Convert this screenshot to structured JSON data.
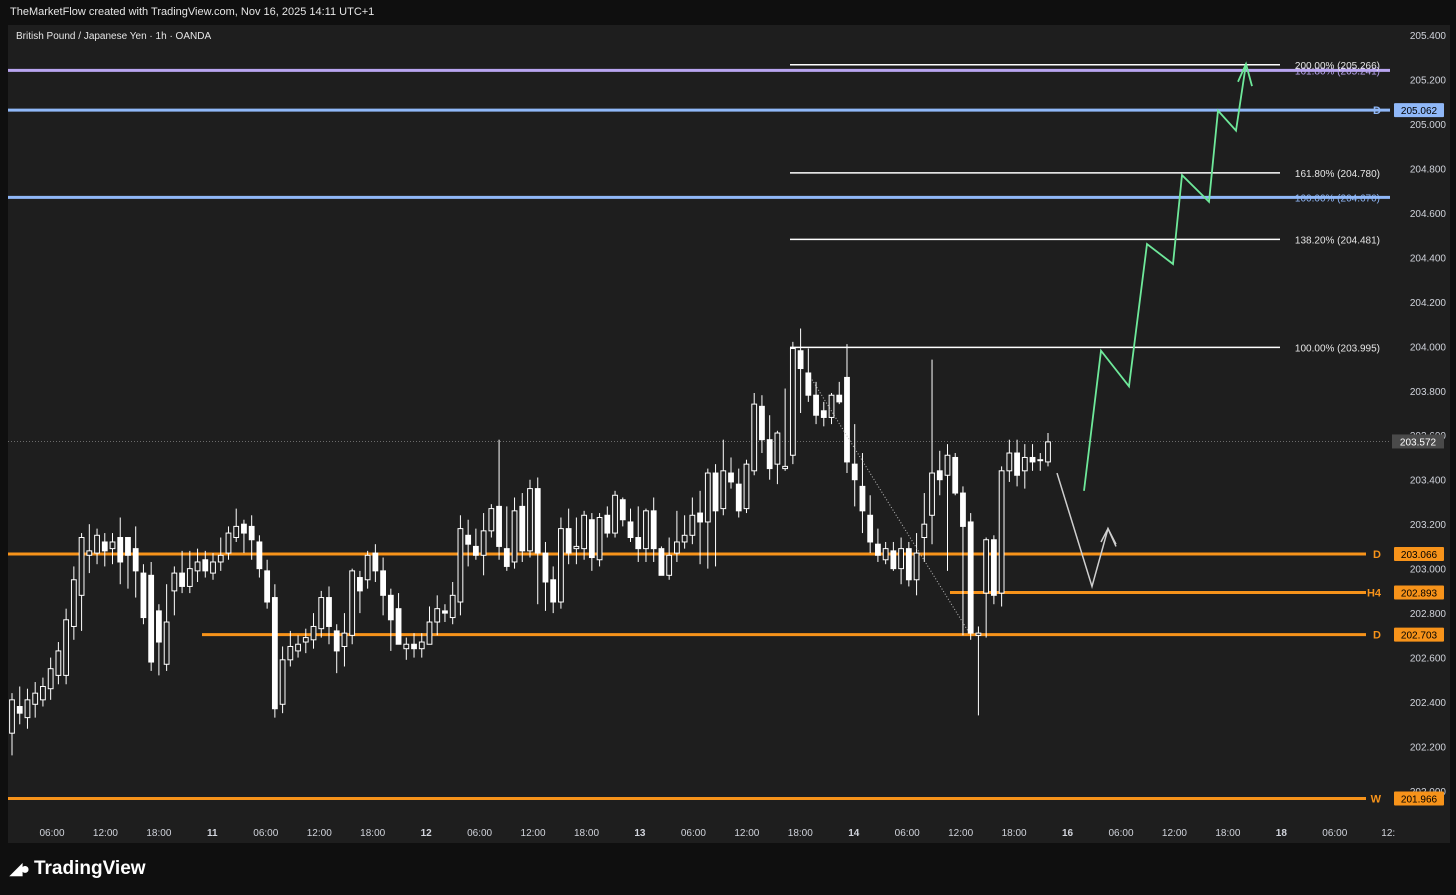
{
  "header": {
    "attribution": "TheMarketFlow created with TradingView.com, Nov 16, 2025 14:11 UTC+1",
    "symbol_title": "British Pound / Japanese Yen · 1h · OANDA"
  },
  "footer": {
    "brand": "TradingView"
  },
  "colors": {
    "background": "#1e1e1e",
    "bull_candle": "#ffffff",
    "bear_candle": "#ffffff",
    "orange_level": "#f7931a",
    "blue_level": "#90b8f8",
    "purple_level": "#b9a5f0",
    "projection_green": "#6ee89a",
    "projection_white": "#cfcfcf",
    "fib_line": "#ffffff"
  },
  "chart_data": {
    "type": "candlestick",
    "title": "British Pound / Japanese Yen · 1h · OANDA",
    "y_axis": {
      "ticks": [
        "205.400",
        "205.200",
        "205.000",
        "204.800",
        "204.600",
        "204.400",
        "204.200",
        "204.000",
        "203.800",
        "203.600",
        "203.400",
        "203.200",
        "203.000",
        "202.800",
        "202.600",
        "202.400",
        "202.200",
        "202.000"
      ],
      "range": [
        201.9,
        205.45
      ]
    },
    "x_axis": {
      "ticks": [
        "06:00",
        "12:00",
        "18:00",
        "11",
        "06:00",
        "12:00",
        "18:00",
        "12",
        "06:00",
        "12:00",
        "18:00",
        "13",
        "06:00",
        "12:00",
        "18:00",
        "14",
        "06:00",
        "12:00",
        "18:00",
        "16",
        "06:00",
        "12:00",
        "18:00",
        "18",
        "06:00",
        "12:"
      ]
    },
    "current_price": "203.572",
    "horizontal_levels": [
      {
        "label": "D",
        "value": "205.062",
        "color": "blue"
      },
      {
        "label": "",
        "value": "204.670",
        "text": "100.00% (204.670)",
        "color": "blue"
      },
      {
        "label": "",
        "value": "205.241",
        "text": "161.80% (205.241)",
        "color": "purple"
      },
      {
        "label": "D",
        "value": "203.066",
        "color": "orange"
      },
      {
        "label": "H4",
        "value": "202.893",
        "color": "orange"
      },
      {
        "label": "D",
        "value": "202.703",
        "color": "orange"
      },
      {
        "label": "W",
        "value": "201.966",
        "color": "orange"
      }
    ],
    "fib_extensions": [
      {
        "text": "200.00% (205.266)",
        "value": 205.266
      },
      {
        "text": "161.80% (204.780)",
        "value": 204.78
      },
      {
        "text": "138.20% (204.481)",
        "value": 204.481
      },
      {
        "text": "100.00% (203.995)",
        "value": 203.995
      }
    ],
    "projection_path_green": [
      [
        1,
        203.35
      ],
      [
        2,
        203.98
      ],
      [
        3,
        203.82
      ],
      [
        4,
        204.46
      ],
      [
        5,
        204.37
      ],
      [
        6,
        204.77
      ],
      [
        7,
        204.65
      ],
      [
        8,
        205.06
      ],
      [
        9,
        204.97
      ],
      [
        10,
        205.27
      ]
    ],
    "projection_path_white": [
      [
        1,
        203.43
      ],
      [
        2,
        202.92
      ],
      [
        3,
        203.18
      ],
      [
        4,
        203.11
      ]
    ],
    "candles": [
      [
        202.26,
        202.41,
        202.16,
        202.44
      ],
      [
        202.38,
        202.35,
        202.3,
        202.47
      ],
      [
        202.33,
        202.41,
        202.28,
        202.46
      ],
      [
        202.39,
        202.44,
        202.33,
        202.49
      ],
      [
        202.41,
        202.47,
        202.38,
        202.51
      ],
      [
        202.46,
        202.55,
        202.41,
        202.6
      ],
      [
        202.52,
        202.63,
        202.48,
        202.67
      ],
      [
        202.52,
        202.77,
        202.48,
        202.82
      ],
      [
        202.74,
        202.95,
        202.68,
        203.01
      ],
      [
        202.88,
        203.14,
        202.72,
        203.16
      ],
      [
        203.06,
        203.08,
        202.98,
        203.2
      ],
      [
        203.07,
        203.15,
        203.02,
        203.18
      ],
      [
        203.12,
        203.08,
        203.01,
        203.16
      ],
      [
        203.09,
        203.12,
        203.02,
        203.16
      ],
      [
        203.14,
        203.03,
        202.93,
        203.23
      ],
      [
        203.14,
        203.06,
        202.91,
        203.14
      ],
      [
        203.09,
        202.99,
        202.87,
        203.19
      ],
      [
        202.98,
        202.78,
        202.75,
        203.02
      ],
      [
        202.97,
        202.58,
        202.54,
        203.03
      ],
      [
        202.81,
        202.67,
        202.52,
        202.84
      ],
      [
        202.57,
        202.76,
        202.54,
        202.93
      ],
      [
        202.9,
        202.98,
        202.79,
        203.01
      ],
      [
        202.98,
        202.92,
        202.89,
        203.08
      ],
      [
        202.92,
        203.0,
        202.89,
        203.08
      ],
      [
        202.99,
        203.03,
        202.94,
        203.09
      ],
      [
        203.04,
        202.99,
        202.96,
        203.08
      ],
      [
        202.98,
        203.03,
        202.95,
        203.07
      ],
      [
        203.03,
        203.06,
        202.99,
        203.14
      ],
      [
        203.07,
        203.16,
        203.04,
        203.19
      ],
      [
        203.14,
        203.19,
        203.12,
        203.27
      ],
      [
        203.2,
        203.16,
        203.07,
        203.22
      ],
      [
        203.19,
        203.13,
        203.04,
        203.24
      ],
      [
        203.12,
        203.0,
        202.96,
        203.15
      ],
      [
        202.99,
        202.85,
        202.82,
        203.04
      ],
      [
        202.87,
        202.37,
        202.33,
        202.93
      ],
      [
        202.39,
        202.59,
        202.35,
        202.65
      ],
      [
        202.59,
        202.65,
        202.56,
        202.72
      ],
      [
        202.63,
        202.66,
        202.6,
        202.7
      ],
      [
        202.67,
        202.69,
        202.62,
        202.73
      ],
      [
        202.68,
        202.74,
        202.64,
        202.8
      ],
      [
        202.73,
        202.87,
        202.69,
        202.9
      ],
      [
        202.87,
        202.74,
        202.66,
        202.92
      ],
      [
        202.72,
        202.63,
        202.53,
        202.75
      ],
      [
        202.65,
        202.71,
        202.56,
        202.8
      ],
      [
        202.7,
        202.99,
        202.66,
        203.0
      ],
      [
        202.96,
        202.9,
        202.8,
        202.99
      ],
      [
        202.95,
        203.06,
        202.91,
        203.08
      ],
      [
        203.07,
        202.99,
        202.94,
        203.11
      ],
      [
        202.99,
        202.88,
        202.79,
        203.05
      ],
      [
        202.88,
        202.77,
        202.63,
        202.91
      ],
      [
        202.82,
        202.66,
        202.66,
        202.89
      ],
      [
        202.64,
        202.66,
        202.59,
        202.69
      ],
      [
        202.66,
        202.64,
        202.6,
        202.71
      ],
      [
        202.64,
        202.67,
        202.6,
        202.71
      ],
      [
        202.66,
        202.76,
        202.66,
        202.83
      ],
      [
        202.76,
        202.82,
        202.7,
        202.88
      ],
      [
        202.81,
        202.8,
        202.76,
        202.84
      ],
      [
        202.78,
        202.88,
        202.75,
        202.94
      ],
      [
        202.85,
        203.18,
        202.79,
        203.24
      ],
      [
        203.15,
        203.11,
        203.01,
        203.22
      ],
      [
        203.1,
        203.06,
        203.04,
        203.18
      ],
      [
        203.06,
        203.17,
        202.97,
        203.25
      ],
      [
        203.17,
        203.27,
        203.14,
        203.29
      ],
      [
        203.28,
        203.1,
        203.04,
        203.58
      ],
      [
        203.09,
        203.01,
        202.99,
        203.28
      ],
      [
        203.03,
        203.26,
        203.0,
        203.32
      ],
      [
        203.28,
        203.08,
        203.03,
        203.34
      ],
      [
        203.08,
        203.36,
        203.05,
        203.4
      ],
      [
        203.36,
        203.07,
        202.84,
        203.41
      ],
      [
        203.07,
        202.94,
        202.81,
        203.12
      ],
      [
        202.95,
        202.85,
        202.8,
        203.01
      ],
      [
        202.85,
        203.18,
        202.82,
        203.23
      ],
      [
        203.18,
        203.07,
        203.02,
        203.27
      ],
      [
        203.09,
        203.1,
        203.02,
        203.23
      ],
      [
        203.09,
        203.24,
        203.04,
        203.26
      ],
      [
        203.22,
        203.05,
        202.99,
        203.25
      ],
      [
        203.04,
        203.23,
        203.01,
        203.25
      ],
      [
        203.24,
        203.16,
        203.14,
        203.28
      ],
      [
        203.16,
        203.33,
        203.14,
        203.35
      ],
      [
        203.31,
        203.22,
        203.19,
        203.32
      ],
      [
        203.21,
        203.14,
        203.12,
        203.27
      ],
      [
        203.14,
        203.09,
        203.03,
        203.28
      ],
      [
        203.09,
        203.26,
        203.03,
        203.27
      ],
      [
        203.26,
        203.09,
        203.03,
        203.32
      ],
      [
        203.09,
        202.97,
        202.97,
        203.1
      ],
      [
        202.97,
        203.06,
        202.95,
        203.14
      ],
      [
        203.07,
        203.12,
        203.03,
        203.26
      ],
      [
        203.12,
        203.15,
        203.09,
        203.24
      ],
      [
        203.15,
        203.24,
        203.11,
        203.32
      ],
      [
        203.25,
        203.21,
        203.02,
        203.35
      ],
      [
        203.21,
        203.43,
        203.0,
        203.45
      ],
      [
        203.43,
        203.26,
        203.01,
        203.47
      ],
      [
        203.27,
        203.44,
        203.24,
        203.58
      ],
      [
        203.43,
        203.39,
        203.36,
        203.5
      ],
      [
        203.38,
        203.26,
        203.23,
        203.45
      ],
      [
        203.27,
        203.47,
        203.25,
        203.49
      ],
      [
        203.44,
        203.74,
        203.42,
        203.79
      ],
      [
        203.73,
        203.58,
        203.52,
        203.78
      ],
      [
        203.58,
        203.45,
        203.4,
        203.69
      ],
      [
        203.47,
        203.61,
        203.38,
        203.62
      ],
      [
        203.45,
        203.46,
        203.44,
        203.81
      ],
      [
        203.51,
        203.99,
        203.47,
        204.02
      ],
      [
        203.98,
        203.9,
        203.7,
        204.08
      ],
      [
        203.88,
        203.78,
        203.75,
        203.99
      ],
      [
        203.78,
        203.69,
        203.65,
        203.84
      ],
      [
        203.71,
        203.68,
        203.64,
        203.75
      ],
      [
        203.68,
        203.78,
        203.65,
        203.79
      ],
      [
        203.78,
        203.75,
        203.74,
        203.84
      ],
      [
        203.86,
        203.48,
        203.43,
        204.01
      ],
      [
        203.47,
        203.4,
        203.28,
        203.65
      ],
      [
        203.37,
        203.26,
        203.16,
        203.52
      ],
      [
        203.24,
        203.12,
        203.07,
        203.33
      ],
      [
        203.11,
        203.06,
        203.03,
        203.18
      ],
      [
        203.04,
        203.09,
        203.02,
        203.12
      ],
      [
        203.08,
        203.0,
        202.99,
        203.12
      ],
      [
        203.0,
        203.09,
        202.93,
        203.14
      ],
      [
        203.09,
        202.95,
        202.92,
        203.12
      ],
      [
        202.95,
        203.07,
        202.88,
        203.16
      ],
      [
        203.14,
        203.2,
        203.03,
        203.34
      ],
      [
        203.24,
        203.43,
        203.11,
        203.94
      ],
      [
        203.44,
        203.4,
        203.33,
        203.53
      ],
      [
        203.42,
        203.51,
        202.99,
        203.56
      ],
      [
        203.5,
        203.34,
        203.33,
        203.52
      ],
      [
        203.34,
        203.19,
        202.7,
        203.37
      ],
      [
        203.21,
        202.71,
        202.68,
        203.25
      ],
      [
        202.7,
        202.71,
        202.34,
        202.74
      ],
      [
        202.89,
        203.13,
        202.69,
        203.14
      ],
      [
        203.13,
        202.88,
        202.84,
        203.15
      ],
      [
        202.89,
        203.44,
        202.83,
        203.46
      ],
      [
        203.44,
        203.52,
        203.39,
        203.58
      ],
      [
        203.52,
        203.42,
        203.37,
        203.58
      ],
      [
        203.44,
        203.5,
        203.36,
        203.56
      ],
      [
        203.5,
        203.48,
        203.44,
        203.56
      ],
      [
        203.49,
        203.49,
        203.44,
        203.52
      ],
      [
        203.48,
        203.57,
        203.46,
        203.61
      ]
    ]
  }
}
